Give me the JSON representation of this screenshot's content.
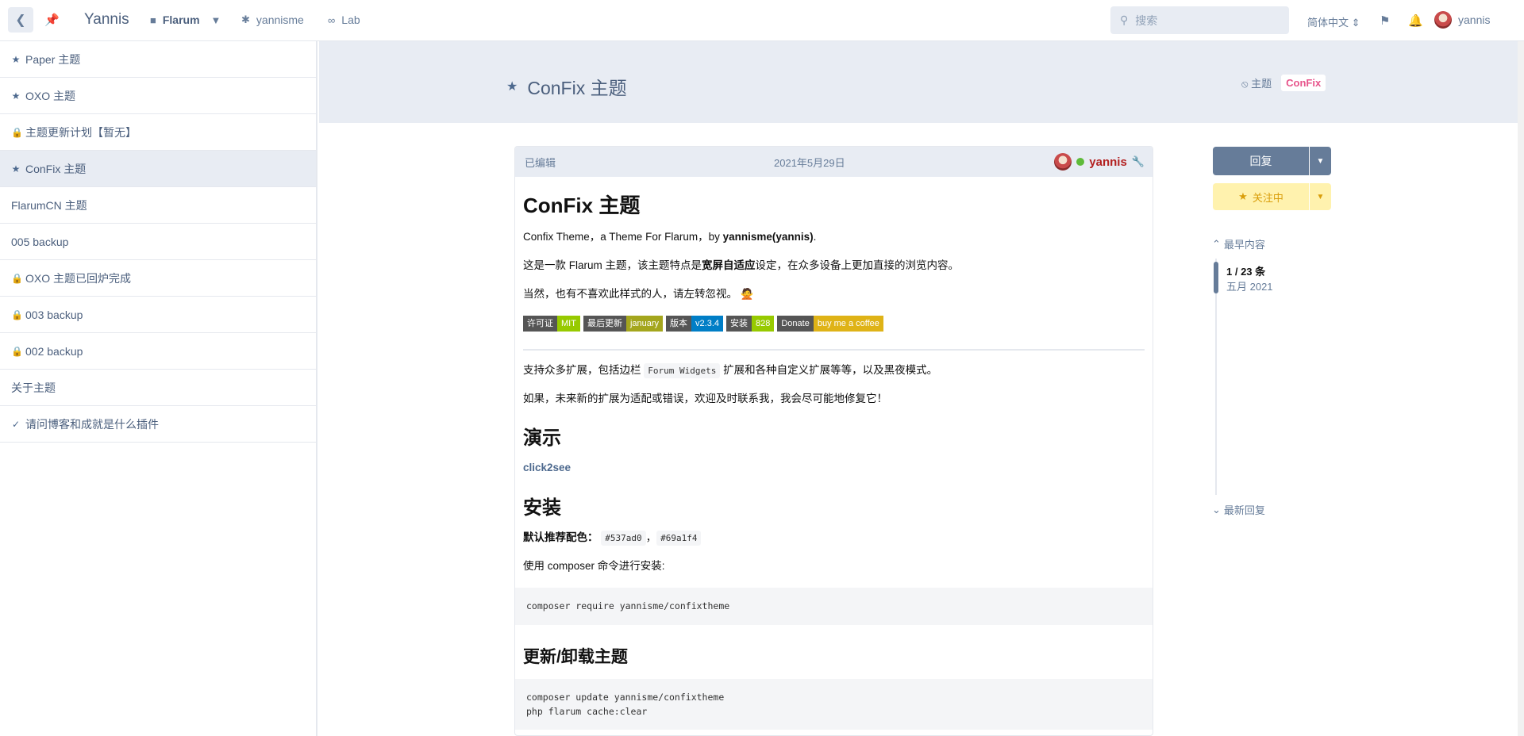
{
  "header": {
    "brand": "Yannis",
    "nav": [
      {
        "label": "Flarum",
        "icon": "comment-icon"
      },
      {
        "label": "yannisme",
        "icon": "asterisk-icon"
      },
      {
        "label": "Lab",
        "icon": "rss-icon"
      }
    ],
    "search_placeholder": "搜索",
    "language": "简体中文",
    "username": "yannis"
  },
  "sidebar": {
    "items": [
      {
        "label": "Paper 主题",
        "icon": "star"
      },
      {
        "label": "OXO 主题",
        "icon": "star"
      },
      {
        "label": "主题更新计划【暂无】",
        "icon": "lock"
      },
      {
        "label": "ConFix 主题",
        "icon": "star"
      },
      {
        "label": "FlarumCN 主题",
        "icon": ""
      },
      {
        "label": "005 backup",
        "icon": ""
      },
      {
        "label": "OXO 主题已回炉完成",
        "icon": "lock"
      },
      {
        "label": "003 backup",
        "icon": "lock"
      },
      {
        "label": "002 backup",
        "icon": "lock"
      },
      {
        "label": "关于主题",
        "icon": ""
      },
      {
        "label": "请问博客和成就是什么插件",
        "icon": "check"
      }
    ]
  },
  "hero": {
    "title": "ConFix 主题",
    "tags": [
      "主题",
      "ConFix"
    ]
  },
  "post": {
    "edited": "已编辑",
    "date": "2021年5月29日",
    "author": "yannis",
    "h1": "ConFix 主题",
    "p1_prefix": "Confix Theme，a Theme For Flarum，by ",
    "p1_bold": "yannisme(yannis)",
    "p1_suffix": ".",
    "p2_prefix": "这是一款 Flarum 主题，该主题特点是",
    "p2_bold": "宽屏自适应",
    "p2_suffix": "设定，在众多设备上更加直接的浏览内容。",
    "p3": "当然，也有不喜欢此样式的人，请左转忽视。",
    "emoji": "🙅",
    "badges": [
      {
        "left": "许可证",
        "right": "MIT",
        "color": "#97ca00"
      },
      {
        "left": "最后更新",
        "right": "january",
        "color": "#a4a61d"
      },
      {
        "left": "版本",
        "right": "v2.3.4",
        "color": "#007ec6"
      },
      {
        "left": "安装",
        "right": "828",
        "color": "#97ca00"
      },
      {
        "left": "Donate",
        "right": "buy me a coffee",
        "color": "#dfb317"
      }
    ],
    "p4_prefix": "支持众多扩展，包括边栏 ",
    "p4_code": "Forum Widgets",
    "p4_suffix": " 扩展和各种自定义扩展等等，以及黑夜模式。",
    "p5": "如果，未来新的扩展为适配或错误，欢迎及时联系我，我会尽可能地修复它！",
    "h2_demo": "演示",
    "demo_link": "click2see",
    "h2_install": "安装",
    "install_label": "默认推荐配色：",
    "color1": "#537ad0",
    "color_sep": "，",
    "color2": "#69a1f4",
    "install_cmd_text": "使用 composer 命令进行安装:",
    "install_cmd": "composer require yannisme/confixtheme",
    "h3_update": "更新/卸载主题",
    "update_cmd1": "composer update yannisme/confixtheme",
    "update_cmd2": "php flarum cache:clear"
  },
  "aside": {
    "reply": "回复",
    "follow": "关注中",
    "earliest": "最早内容",
    "count": "1 / 23 条",
    "month": "五月 2021",
    "latest": "最新回复"
  }
}
